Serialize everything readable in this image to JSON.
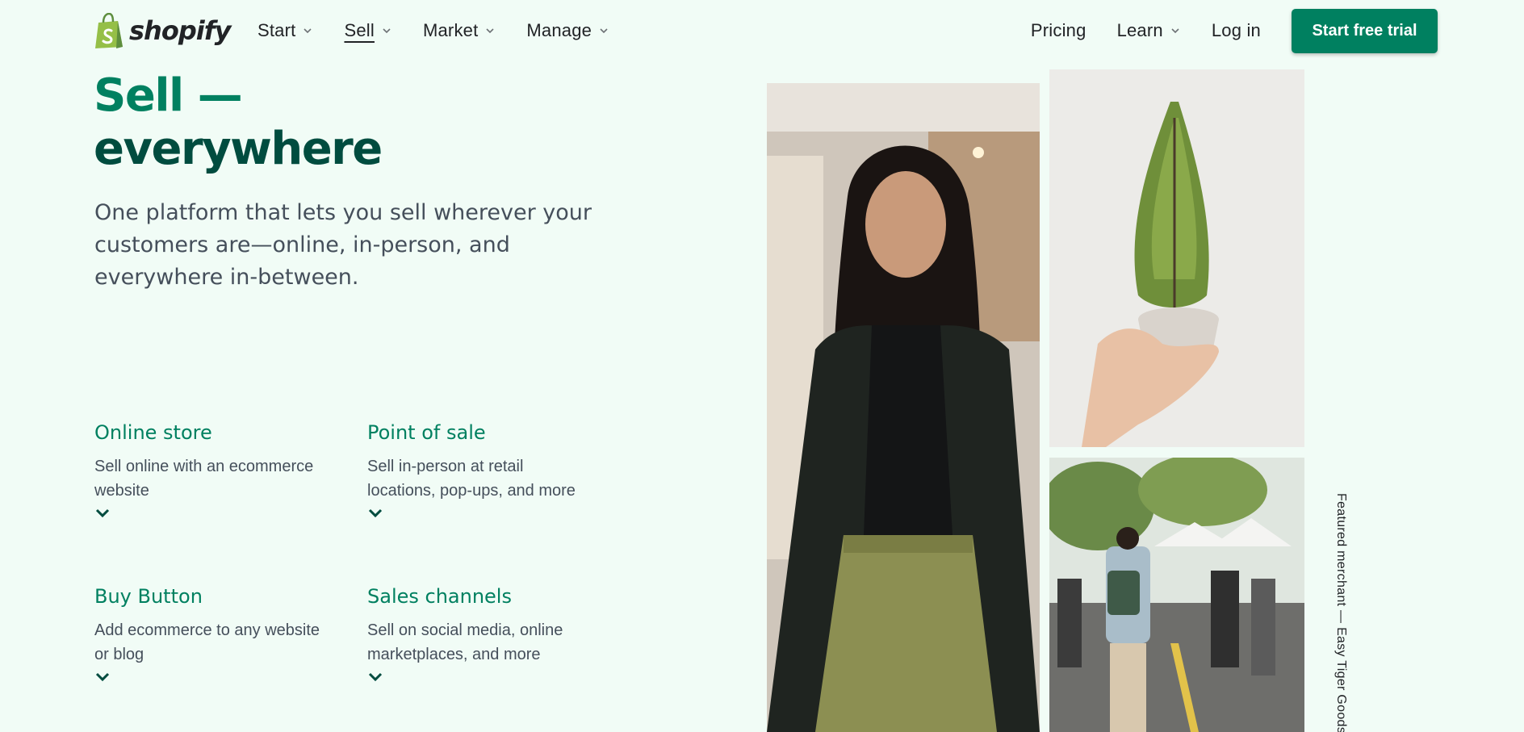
{
  "brand": {
    "name": "shopify",
    "primary_color": "#008060",
    "dark_color": "#004c3f",
    "logo_bag_color": "#95bf47",
    "background_color": "#f1fcf6"
  },
  "nav": {
    "left": [
      {
        "label": "Start",
        "icon": "chevron-down-icon"
      },
      {
        "label": "Sell",
        "icon": "chevron-down-icon",
        "active": true
      },
      {
        "label": "Market",
        "icon": "chevron-down-icon"
      },
      {
        "label": "Manage",
        "icon": "chevron-down-icon"
      }
    ],
    "right": [
      {
        "label": "Pricing"
      },
      {
        "label": "Learn",
        "icon": "chevron-down-icon"
      },
      {
        "label": "Log in"
      }
    ],
    "cta_label": "Start free trial"
  },
  "hero": {
    "title_line1": "Sell —",
    "title_line2": "everywhere",
    "subtitle": "One platform that lets you sell wherever your customers are—online, in-person, and everywhere in-between."
  },
  "features": [
    {
      "title": "Online store",
      "description": "Sell online with an ecommerce website",
      "icon": "chevron-down-icon"
    },
    {
      "title": "Point of sale",
      "description": "Sell in-person at retail locations, pop-ups, and more",
      "icon": "chevron-down-icon"
    },
    {
      "title": "Buy Button",
      "description": "Add ecommerce to any website or blog",
      "icon": "chevron-down-icon"
    },
    {
      "title": "Sales channels",
      "description": "Sell on social media, online marketplaces, and more",
      "icon": "chevron-down-icon"
    }
  ],
  "images": {
    "merchant_photo": "merchant-portrait-image",
    "plant_photo": "potted-plant-image",
    "market_photo": "street-market-image"
  },
  "caption": "Featured merchant — Easy Tiger Goods"
}
